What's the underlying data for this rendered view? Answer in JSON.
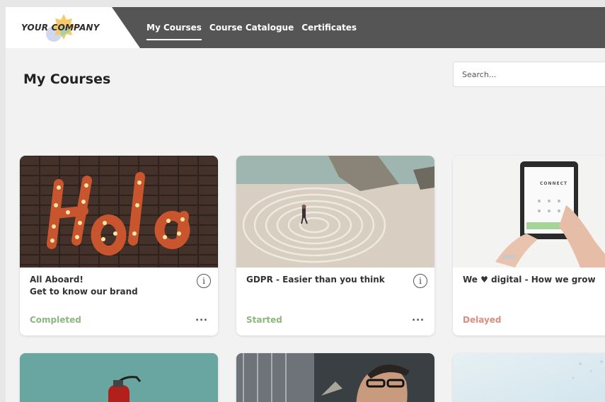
{
  "brand": {
    "logo_text": "YOUR COMPANY"
  },
  "nav": {
    "items": [
      {
        "label": "My Courses",
        "active": true
      },
      {
        "label": "Course Catalogue",
        "active": false
      },
      {
        "label": "Certificates",
        "active": false
      }
    ]
  },
  "page": {
    "title": "My Courses"
  },
  "search": {
    "placeholder": "Search..."
  },
  "courses": [
    {
      "title_line1": "All Aboard!",
      "title_line2": "Get to know our brand",
      "status": "Completed",
      "status_color": "#8bb87c",
      "image": "hola-marquee-sign"
    },
    {
      "title_line1": "GDPR - Easier than you think",
      "title_line2": "",
      "status": "Started",
      "status_color": "#8bb87c",
      "image": "beach-labyrinth"
    },
    {
      "title_line1": "We ♥ digital - How we grow",
      "title_line2": "",
      "status": "Delayed",
      "status_color": "#e08a80",
      "image": "tablet-connect"
    },
    {
      "image": "fire-extinguisher"
    },
    {
      "image": "man-with-glasses-workshop"
    },
    {
      "image": "light-blue-sky"
    }
  ],
  "tablet_screen_text": "CONNECT",
  "info_glyph": "i",
  "more_glyph": "..."
}
